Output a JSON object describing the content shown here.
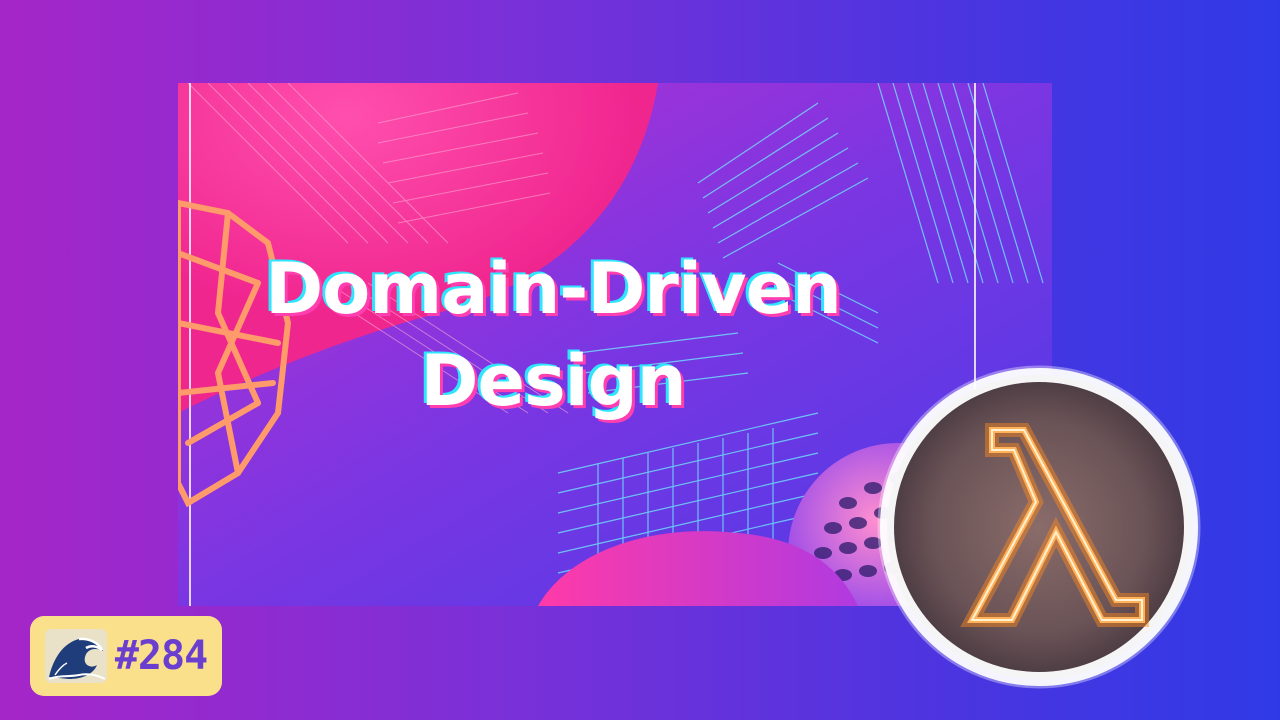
{
  "banner": {
    "title_line1": "Domain-Driven",
    "title_line2": "Design"
  },
  "badge": {
    "episode_number": "#284",
    "icon": "great-wave-icon"
  },
  "logo": {
    "icon": "lambda-icon"
  },
  "colors": {
    "background_left": "#a526c8",
    "background_right": "#2f3ae6",
    "badge_background": "#fbe08b",
    "badge_text": "#6a3fd0",
    "title_text": "#ffffff",
    "title_shadow_pink": "#ff3fb0",
    "title_shadow_cyan": "#2ee6ff",
    "lambda_neon": "#ff8a1c",
    "logo_ring": "#f4f4f4"
  }
}
